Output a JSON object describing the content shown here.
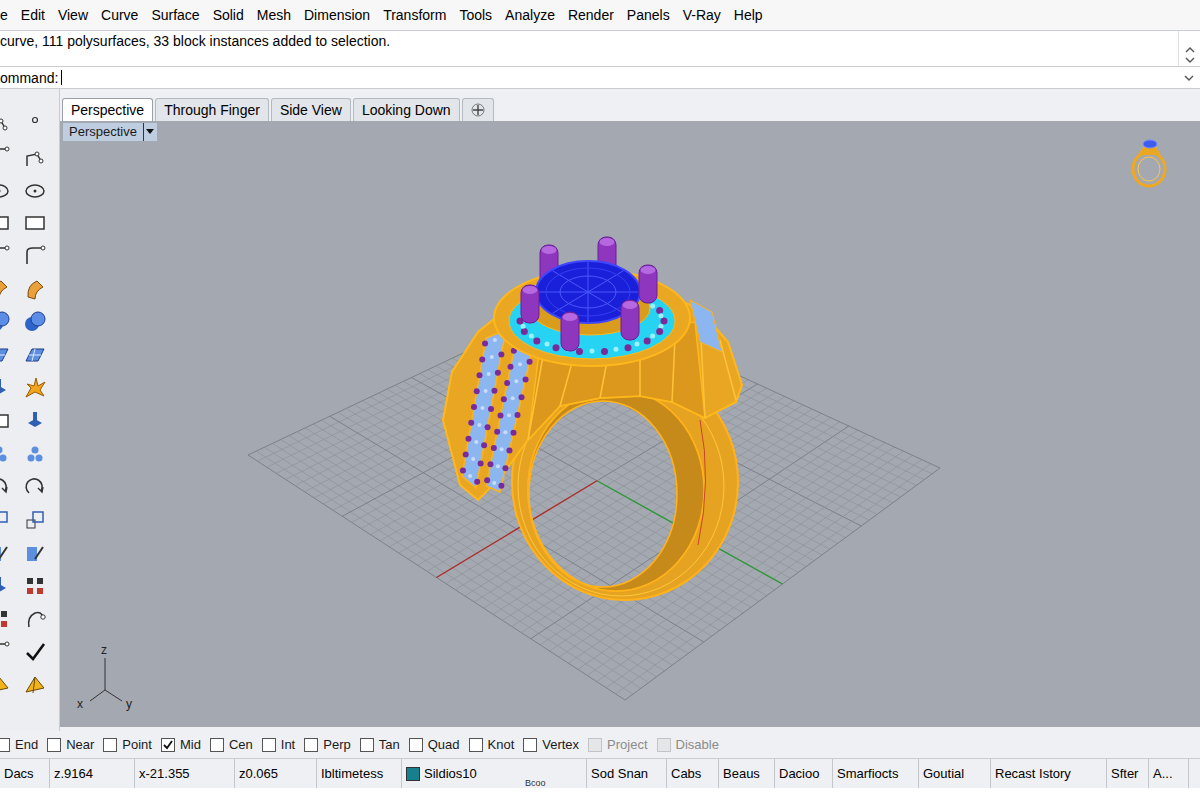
{
  "menu": [
    "e",
    "Edit",
    "View",
    "Curve",
    "Surface",
    "Solid",
    "Mesh",
    "Dimension",
    "Transform",
    "Tools",
    "Analyze",
    "Render",
    "Panels",
    "V-Ray",
    "Help"
  ],
  "command_history": {
    "text": "curve, 111 polysurfaces, 33 block instances added to selection."
  },
  "command_line": {
    "prompt": "ommand:"
  },
  "viewport_tabs": [
    {
      "label": "Perspective",
      "selected": true
    },
    {
      "label": "Through Finger",
      "selected": false
    },
    {
      "label": "Side View",
      "selected": false
    },
    {
      "label": "Looking Down",
      "selected": false
    }
  ],
  "viewport": {
    "title": "Perspective",
    "axes": [
      "z",
      "x",
      "y"
    ]
  },
  "osnaps": [
    {
      "label": "End",
      "checked": false,
      "disabled": false
    },
    {
      "label": "Near",
      "checked": false,
      "disabled": false
    },
    {
      "label": "Point",
      "checked": false,
      "disabled": false
    },
    {
      "label": "Mid",
      "checked": true,
      "disabled": false
    },
    {
      "label": "Cen",
      "checked": false,
      "disabled": false
    },
    {
      "label": "Int",
      "checked": false,
      "disabled": false
    },
    {
      "label": "Perp",
      "checked": false,
      "disabled": false
    },
    {
      "label": "Tan",
      "checked": false,
      "disabled": false
    },
    {
      "label": "Quad",
      "checked": false,
      "disabled": false
    },
    {
      "label": "Knot",
      "checked": false,
      "disabled": false
    },
    {
      "label": "Vertex",
      "checked": false,
      "disabled": false
    },
    {
      "label": "Project",
      "checked": false,
      "disabled": true
    },
    {
      "label": "Disable",
      "checked": false,
      "disabled": true
    }
  ],
  "status_bar": {
    "items": [
      {
        "kind": "text",
        "text": "Dacs"
      },
      {
        "kind": "text",
        "text": "z.9164"
      },
      {
        "kind": "text",
        "text": "x-21.355"
      },
      {
        "kind": "text",
        "text": "z0.065"
      },
      {
        "kind": "text",
        "text": "Ibltimetess"
      },
      {
        "kind": "layer",
        "text": "Sildios10",
        "color": "#17808f"
      },
      {
        "kind": "text",
        "text": "Sod Snan"
      },
      {
        "kind": "text",
        "text": "Cabs"
      },
      {
        "kind": "text",
        "text": "Beaus"
      },
      {
        "kind": "text",
        "text": "Dacioo"
      },
      {
        "kind": "text",
        "text": "Smarfiocts"
      },
      {
        "kind": "text",
        "text": "Goutial"
      },
      {
        "kind": "text",
        "text": "Recast Istory"
      },
      {
        "kind": "text",
        "text": "Sfter"
      },
      {
        "kind": "text",
        "text": "A..."
      }
    ],
    "note": "Bcoo"
  }
}
